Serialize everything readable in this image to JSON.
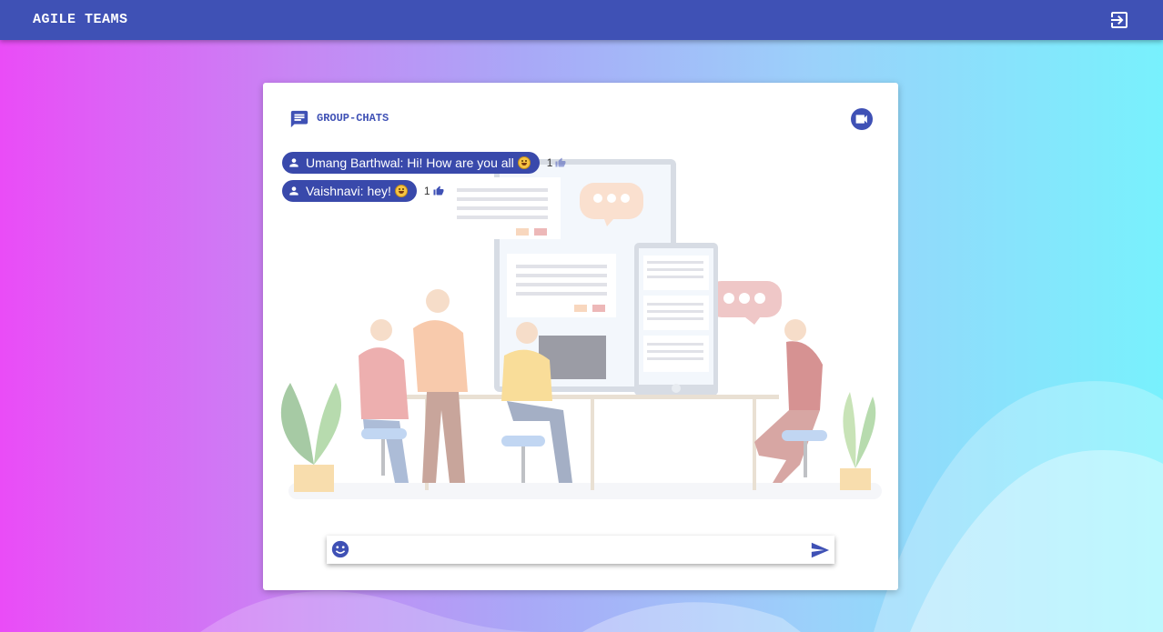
{
  "app": {
    "title": "AGILE TEAMS",
    "logout_icon": "logout-icon"
  },
  "chat": {
    "title": "GROUP-CHATS",
    "header_icon": "chat-icon",
    "video_icon": "video-call-icon",
    "messages": [
      {
        "text": "Umang Barthwal: Hi! How are you all",
        "emoji": "grinning-face",
        "likes": "1"
      },
      {
        "text": "Vaishnavi: hey!",
        "emoji": "grinning-face",
        "likes": "1"
      }
    ],
    "input": {
      "value": "",
      "placeholder": ""
    },
    "emoji_icon": "emoji-icon",
    "send_icon": "send-icon"
  },
  "colors": {
    "primary": "#3f51b5",
    "bubble": "#3949ab"
  }
}
